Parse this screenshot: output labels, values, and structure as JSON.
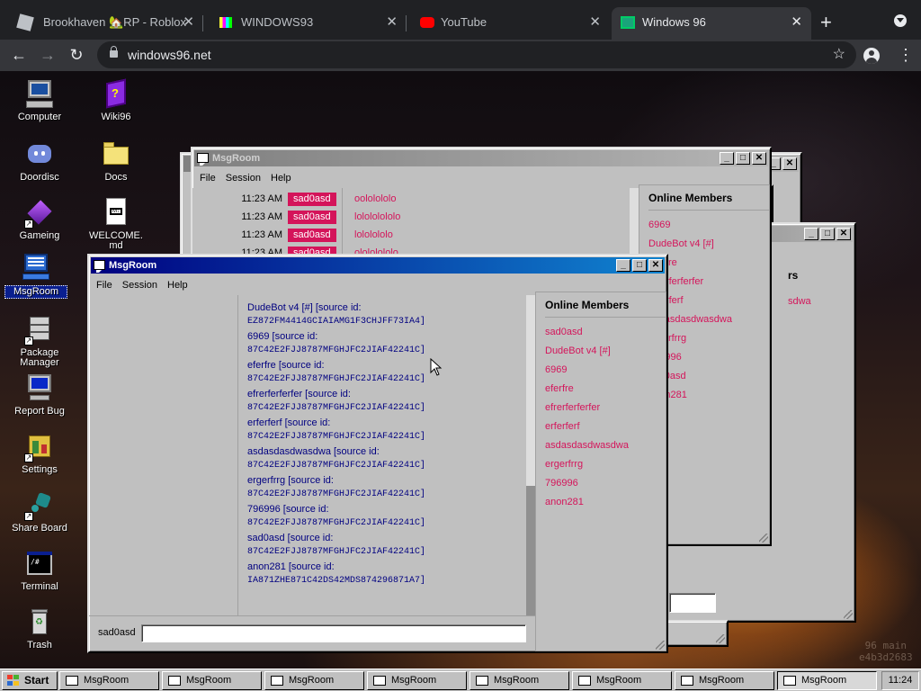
{
  "browser": {
    "tabs": [
      {
        "title": "Brookhaven 🏡RP - Roblox",
        "active": false
      },
      {
        "title": "WINDOWS93",
        "active": false
      },
      {
        "title": "YouTube",
        "active": false
      },
      {
        "title": "Windows 96",
        "active": true
      }
    ],
    "new_tab": "+",
    "url": "windows96.net"
  },
  "desktop": {
    "icons": [
      {
        "label": "Computer",
        "icon": "computer-icon"
      },
      {
        "label": "Wiki96",
        "icon": "book-icon"
      },
      {
        "label": "Doordisc",
        "icon": "discord-icon"
      },
      {
        "label": "Docs",
        "icon": "folder-icon"
      },
      {
        "label": "Gameing",
        "icon": "cube-icon"
      },
      {
        "label": "WELCOME.md",
        "icon": "markdown-file-icon"
      },
      {
        "label": "MsgRoom",
        "icon": "msgroom-icon"
      },
      {
        "label": "Package Manager",
        "icon": "package-icon"
      },
      {
        "label": "Report Bug",
        "icon": "monitor-bug-icon"
      },
      {
        "label": "Settings",
        "icon": "settings-icon"
      },
      {
        "label": "Share Board",
        "icon": "share-icon"
      },
      {
        "label": "Terminal",
        "icon": "terminal-icon"
      },
      {
        "label": "Trash",
        "icon": "recycle-bin-icon"
      }
    ],
    "watermark": " 96 main\ne4b3d2683"
  },
  "back_window": {
    "title": "MsgRoom",
    "menu": [
      "File",
      "Session",
      "Help"
    ],
    "messages": [
      {
        "time": "11:23 AM",
        "user": "sad0asd",
        "text": "oololololo"
      },
      {
        "time": "11:23 AM",
        "user": "sad0asd",
        "text": "lolololololo"
      },
      {
        "time": "11:23 AM",
        "user": "sad0asd",
        "text": "lololololo"
      },
      {
        "time": "11:23 AM",
        "user": "sad0asd",
        "text": "olololololo"
      }
    ],
    "members_title": "Online Members",
    "members": [
      "6969",
      "DudeBot v4 [#]",
      "eferfre",
      "efrerferferfer",
      "erferferf",
      "asdasdasdwasdwa",
      "ergerfrrg",
      "796996",
      "sad0asd",
      "anon281"
    ]
  },
  "stack_window": {
    "members_title": "Online Members",
    "members_partial": "rs",
    "member_partial": "sdwa"
  },
  "front_window": {
    "title": "MsgRoom",
    "menu": [
      "File",
      "Session",
      "Help"
    ],
    "log": [
      {
        "name": "DudeBot v4 [#] [source id:",
        "src": "EZ872FM4414GCIAIAMG1F3CHJFF73IA4]"
      },
      {
        "name": "6969 [source id:",
        "src": "87C42E2FJJ8787MFGHJFC2JIAF42241C]"
      },
      {
        "name": "eferfre [source id:",
        "src": "87C42E2FJJ8787MFGHJFC2JIAF42241C]"
      },
      {
        "name": "efrerferferfer [source id:",
        "src": "87C42E2FJJ8787MFGHJFC2JIAF42241C]"
      },
      {
        "name": "erferferf [source id:",
        "src": "87C42E2FJJ8787MFGHJFC2JIAF42241C]"
      },
      {
        "name": "asdasdasdwasdwa [source id:",
        "src": "87C42E2FJJ8787MFGHJFC2JIAF42241C]"
      },
      {
        "name": "ergerfrrg [source id:",
        "src": "87C42E2FJJ8787MFGHJFC2JIAF42241C]"
      },
      {
        "name": "796996 [source id:",
        "src": "87C42E2FJJ8787MFGHJFC2JIAF42241C]"
      },
      {
        "name": "sad0asd [source id:",
        "src": "87C42E2FJJ8787MFGHJFC2JIAF42241C]"
      },
      {
        "name": "anon281 [source id:",
        "src": "IA871ZHE871C42DS42MDS874296871A7]"
      }
    ],
    "members_title": "Online Members",
    "members": [
      "sad0asd",
      "DudeBot v4 [#]",
      "6969",
      "eferfre",
      "efrerferferfer",
      "erferferf",
      "asdasdasdwasdwa",
      "ergerfrrg",
      "796996",
      "anon281"
    ],
    "nick": "sad0asd",
    "message_value": ""
  },
  "taskbar": {
    "start": "Start",
    "buttons": [
      "MsgRoom",
      "MsgRoom",
      "MsgRoom",
      "MsgRoom",
      "MsgRoom",
      "MsgRoom",
      "MsgRoom",
      "MsgRoom"
    ],
    "clock": "11:24"
  },
  "colors": {
    "accent_pink": "#d4145a",
    "title_active": "#000080",
    "chrome_dark": "#202124"
  }
}
